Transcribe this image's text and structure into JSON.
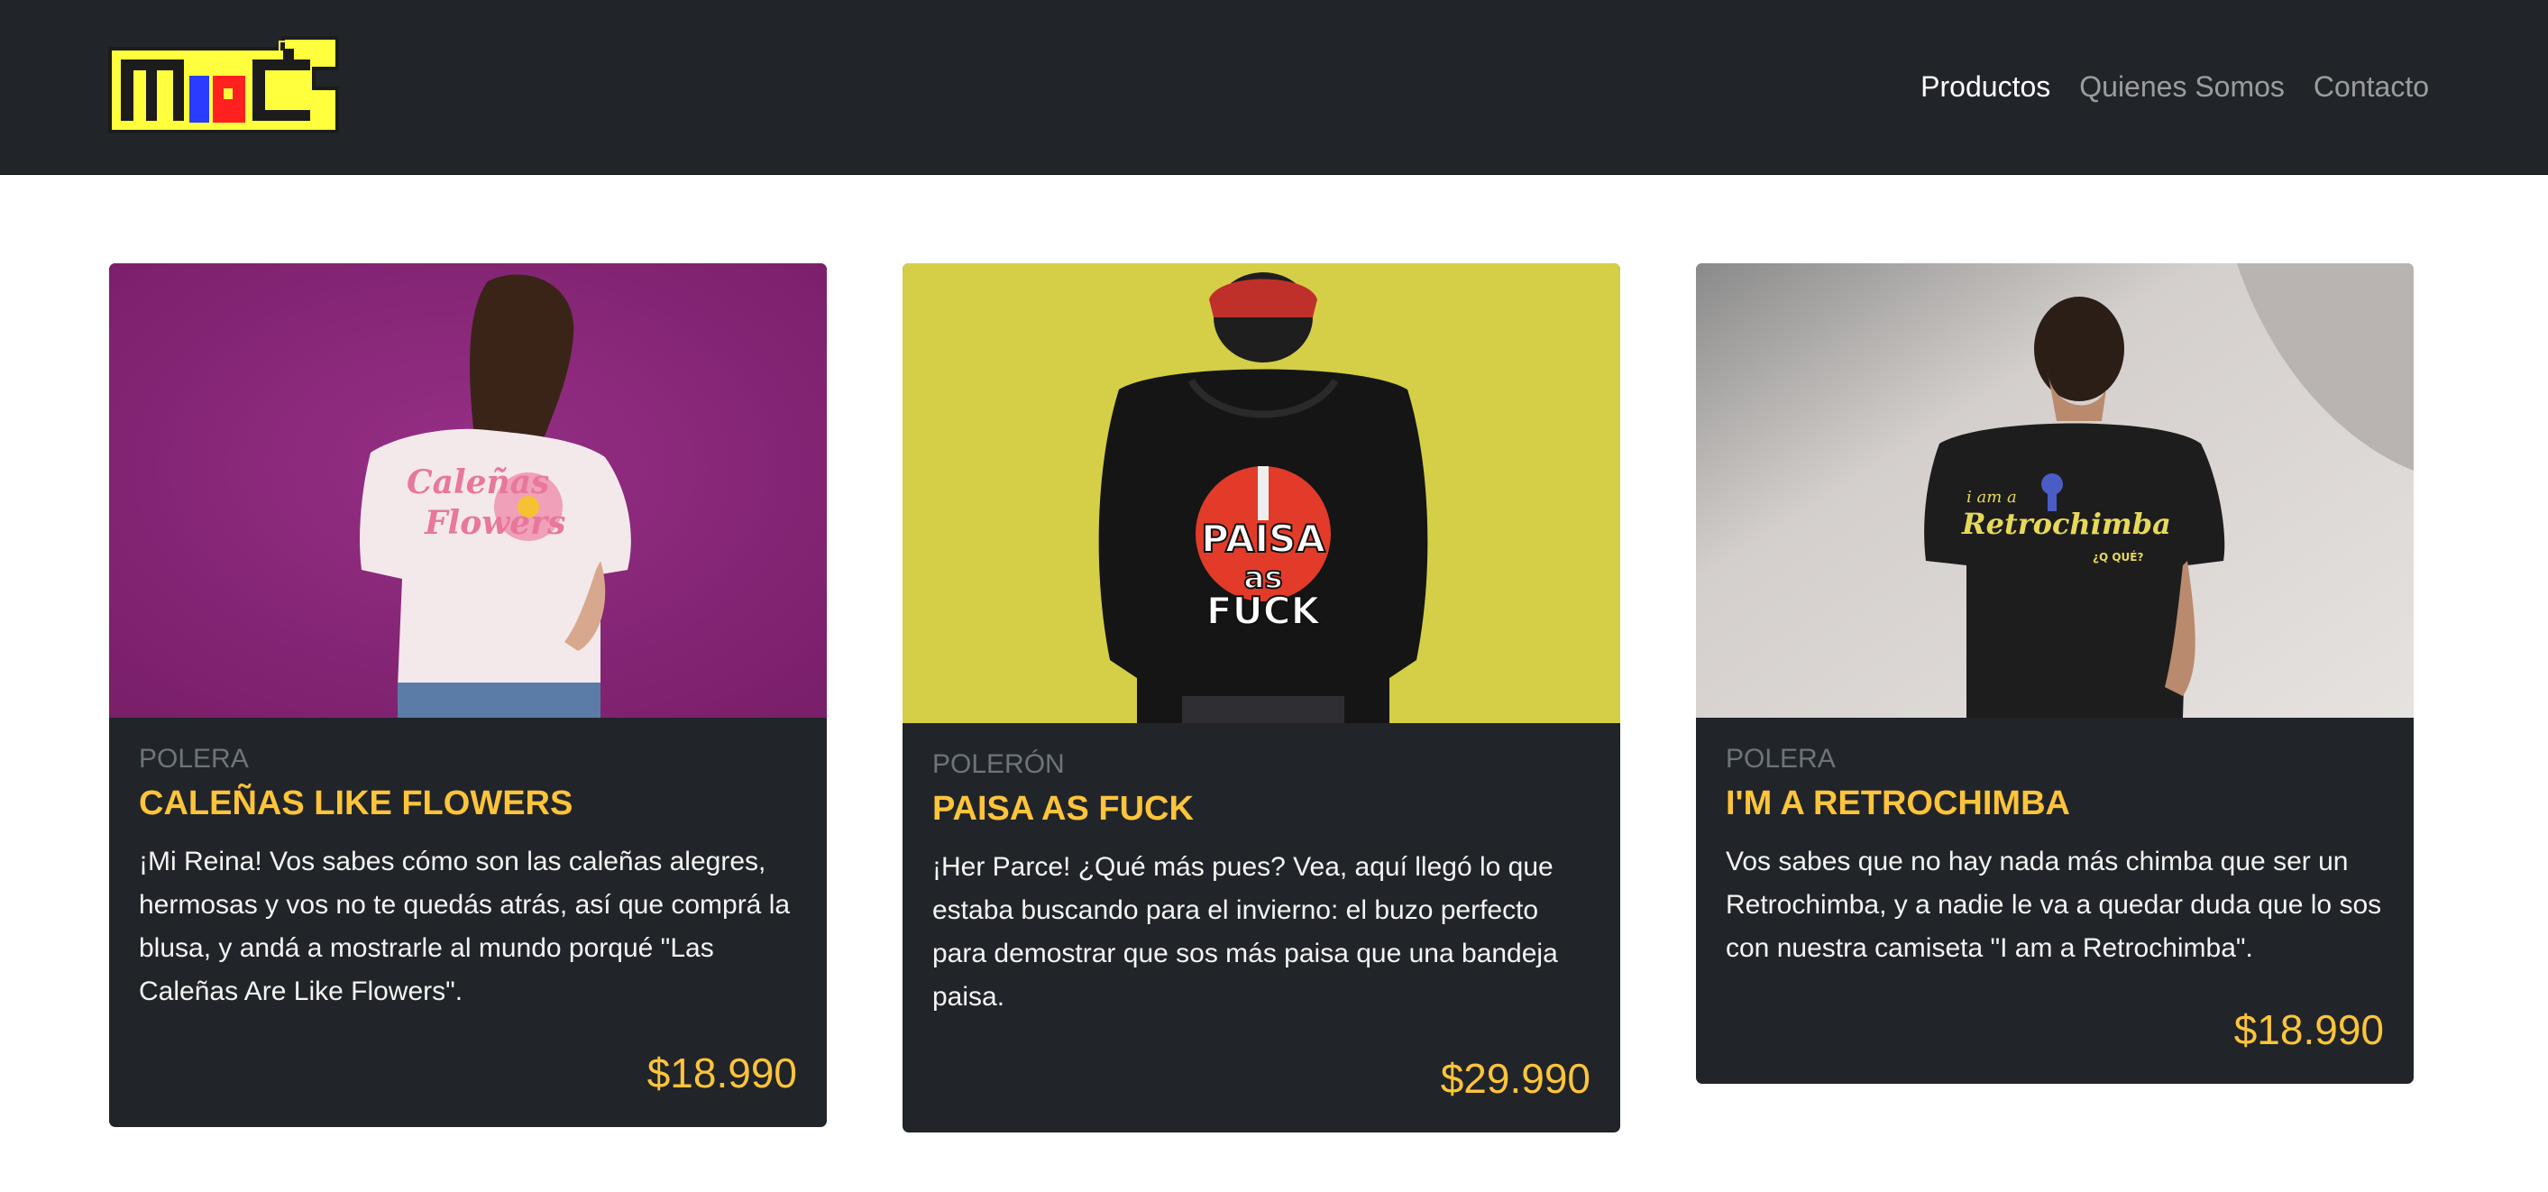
{
  "brand": {
    "logo_text": "MRC",
    "logo_icon": "brand-logo"
  },
  "nav": {
    "items": [
      {
        "label": "Productos",
        "active": true
      },
      {
        "label": "Quienes Somos",
        "active": false
      },
      {
        "label": "Contacto",
        "active": false
      }
    ]
  },
  "colors": {
    "navbar_bg": "#212529",
    "card_bg": "#212529",
    "accent": "#ffc43a",
    "muted": "#6c757d"
  },
  "products": [
    {
      "category": "POLERA",
      "title": "CALEÑAS LIKE FLOWERS",
      "description": "¡Mi Reina! Vos sabes cómo son las caleñas alegres, hermosas y vos no te quedás atrás, así que comprá la blusa, y andá a mostrarle al mundo porqué \"Las Caleñas Are Like Flowers\".",
      "price": "$18.990",
      "image": "woman-white-tshirt-flower-print-photo"
    },
    {
      "category": "POLERÓN",
      "title": "PAISA AS FUCK",
      "description": "¡Her Parce! ¿Qué más pues? Vea, aquí llegó lo que estaba buscando para el invierno: el buzo perfecto para demostrar que sos más paisa que una bandeja paisa.",
      "price": "$29.990",
      "image": "man-black-hoodie-paisa-print-photo"
    },
    {
      "category": "POLERA",
      "title": "I'M A RETROCHIMBA",
      "description": "Vos sabes que no hay nada más chimba que ser un Retrochimba, y a nadie le va a quedar duda que lo sos con nuestra camiseta \"I am a Retrochimba\".",
      "price": "$18.990",
      "image": "man-black-tshirt-retrochimba-print-photo"
    }
  ]
}
